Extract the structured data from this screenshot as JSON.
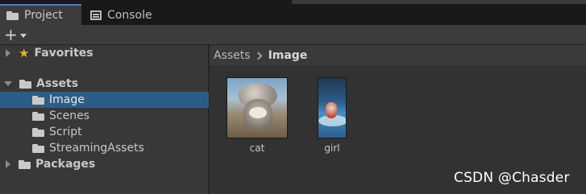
{
  "tabs": [
    {
      "label": "Project",
      "icon": "folder-icon",
      "active": true
    },
    {
      "label": "Console",
      "icon": "console-icon",
      "active": false
    }
  ],
  "toolbar": {
    "add_label": "+"
  },
  "tree": {
    "favorites": "Favorites",
    "assets": "Assets",
    "children": [
      "Image",
      "Scenes",
      "Script",
      "StreamingAssets"
    ],
    "packages": "Packages",
    "selected": "Image"
  },
  "breadcrumb": {
    "root": "Assets",
    "current": "Image"
  },
  "assets": [
    {
      "name": "cat"
    },
    {
      "name": "girl"
    }
  ],
  "watermark": "CSDN @Chasder",
  "colors": {
    "selection": "#2c5d87",
    "star": "#e8b422",
    "tab_accent": "#4c7fbf"
  }
}
